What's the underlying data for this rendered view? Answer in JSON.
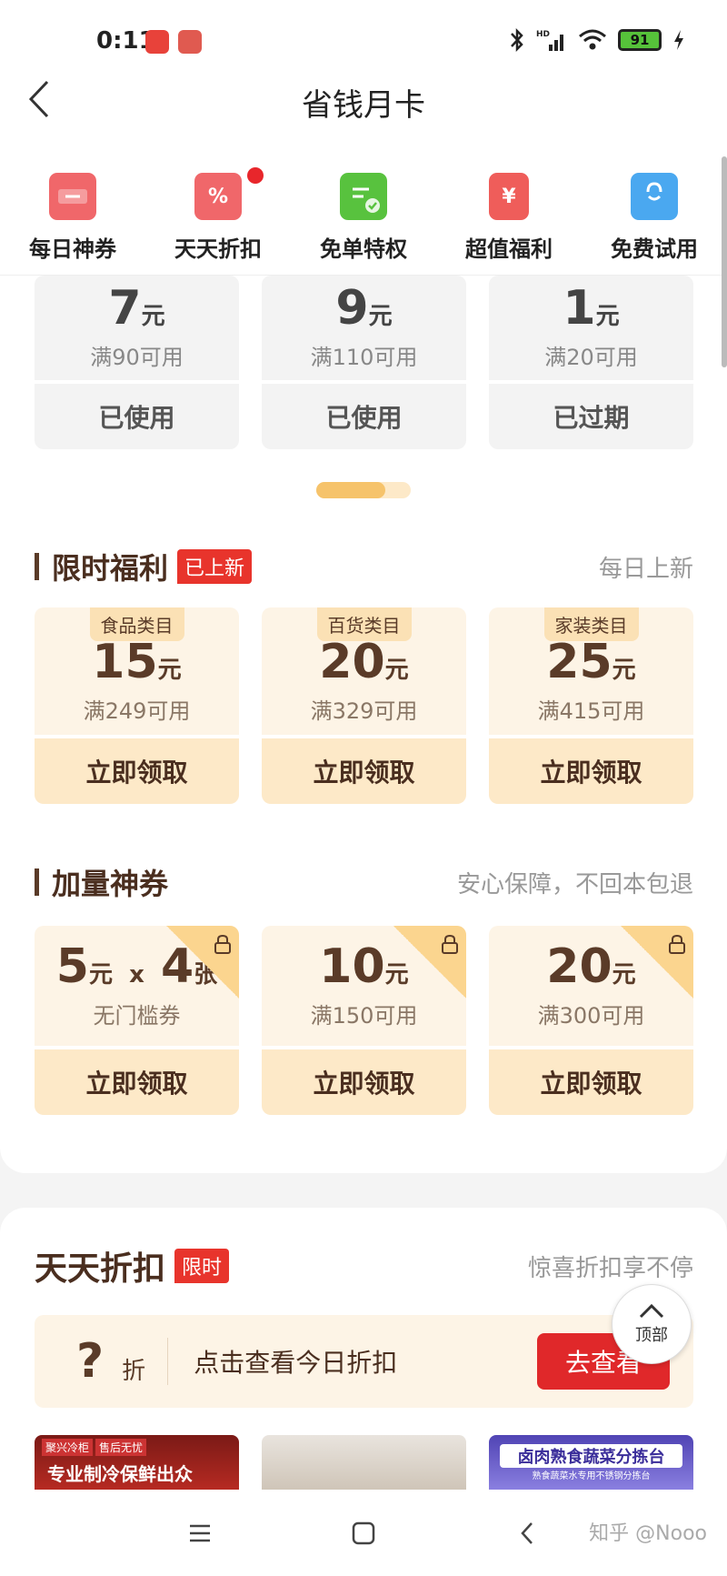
{
  "status": {
    "time": "0:11",
    "battery": "91"
  },
  "header": {
    "title": "省钱月卡"
  },
  "categories": [
    {
      "label": "每日神券",
      "icon": "coupon-icon",
      "color": "#f0676a"
    },
    {
      "label": "天天折扣",
      "icon": "percent-icon",
      "color": "#f0676a",
      "symbol": "%"
    },
    {
      "label": "免单特权",
      "icon": "free-order-icon",
      "color": "#58c23e"
    },
    {
      "label": "超值福利",
      "icon": "yen-envelope-icon",
      "color": "#ef5d5a",
      "symbol": "¥"
    },
    {
      "label": "免费试用",
      "icon": "shopping-bag-icon",
      "color": "#4aa8f0"
    }
  ],
  "used_coupons": [
    {
      "amount": "7",
      "unit": "元",
      "condition": "满90可用",
      "status": "已使用"
    },
    {
      "amount": "9",
      "unit": "元",
      "condition": "满110可用",
      "status": "已使用"
    },
    {
      "amount": "1",
      "unit": "元",
      "condition": "满20可用",
      "status": "已过期"
    }
  ],
  "limited": {
    "title": "限时福利",
    "badge": "已上新",
    "right": "每日上新",
    "coupons": [
      {
        "tag": "食品类目",
        "amount": "15",
        "unit": "元",
        "condition": "满249可用",
        "button": "立即领取"
      },
      {
        "tag": "百货类目",
        "amount": "20",
        "unit": "元",
        "condition": "满329可用",
        "button": "立即领取"
      },
      {
        "tag": "家装类目",
        "amount": "25",
        "unit": "元",
        "condition": "满415可用",
        "button": "立即领取"
      }
    ]
  },
  "extra": {
    "title": "加量神券",
    "right": "安心保障，不回本包退",
    "coupons": [
      {
        "amount": "5",
        "unit": "元",
        "times": "x",
        "count": "4",
        "count_unit": "张",
        "condition": "无门槛券",
        "button": "立即领取"
      },
      {
        "amount": "10",
        "unit": "元",
        "condition": "满150可用",
        "button": "立即领取"
      },
      {
        "amount": "20",
        "unit": "元",
        "condition": "满300可用",
        "button": "立即领取"
      }
    ]
  },
  "discount": {
    "title": "天天折扣",
    "badge": "限时",
    "right": "惊喜折扣享不停",
    "question": "?",
    "zhe": "折",
    "text": "点击查看今日折扣",
    "button": "去查看"
  },
  "back_to_top": "顶部",
  "products": [
    {
      "tag1": "聚兴冷柜",
      "tag2": "售后无忧",
      "text": "专业制冷保鲜出众"
    },
    {},
    {
      "title": "卤肉熟食蔬菜分拣台",
      "sub": "熟食蔬菜水专用不锈钢分拣台"
    }
  ],
  "watermark": "知乎 @Nooo"
}
